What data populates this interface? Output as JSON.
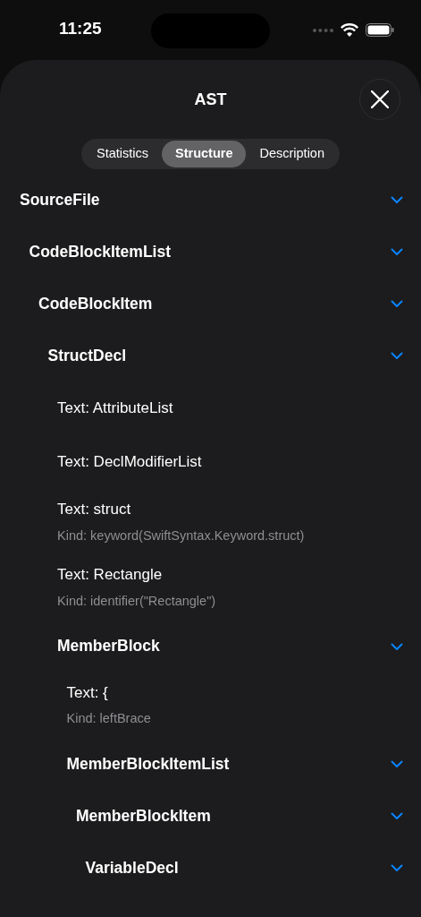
{
  "status_bar": {
    "time": "11:25"
  },
  "sheet": {
    "title": "AST"
  },
  "tabs": [
    {
      "label": "Statistics",
      "selected": false
    },
    {
      "label": "Structure",
      "selected": true
    },
    {
      "label": "Description",
      "selected": false
    }
  ],
  "tree": [
    {
      "kind": "node",
      "label": "SourceFile",
      "expanded": true,
      "children": [
        {
          "kind": "node",
          "label": "CodeBlockItemList",
          "expanded": true,
          "children": [
            {
              "kind": "node",
              "label": "CodeBlockItem",
              "expanded": true,
              "children": [
                {
                  "kind": "node",
                  "label": "StructDecl",
                  "expanded": true,
                  "children": [
                    {
                      "kind": "token",
                      "label": "Text: AttributeList"
                    },
                    {
                      "kind": "token",
                      "label": "Text: DeclModifierList"
                    },
                    {
                      "kind": "token",
                      "label": "Text: struct",
                      "detail": "Kind: keyword(SwiftSyntax.Keyword.struct)"
                    },
                    {
                      "kind": "token",
                      "label": "Text: Rectangle",
                      "detail": "Kind: identifier(\"Rectangle\")"
                    },
                    {
                      "kind": "node",
                      "label": "MemberBlock",
                      "expanded": true,
                      "children": [
                        {
                          "kind": "token",
                          "label": "Text: {",
                          "detail": "Kind: leftBrace"
                        },
                        {
                          "kind": "node",
                          "label": "MemberBlockItemList",
                          "expanded": true,
                          "children": [
                            {
                              "kind": "node",
                              "label": "MemberBlockItem",
                              "expanded": true,
                              "children": [
                                {
                                  "kind": "node",
                                  "label": "VariableDecl",
                                  "expanded": true
                                }
                              ]
                            }
                          ]
                        }
                      ]
                    }
                  ]
                }
              ]
            }
          ]
        }
      ]
    }
  ]
}
